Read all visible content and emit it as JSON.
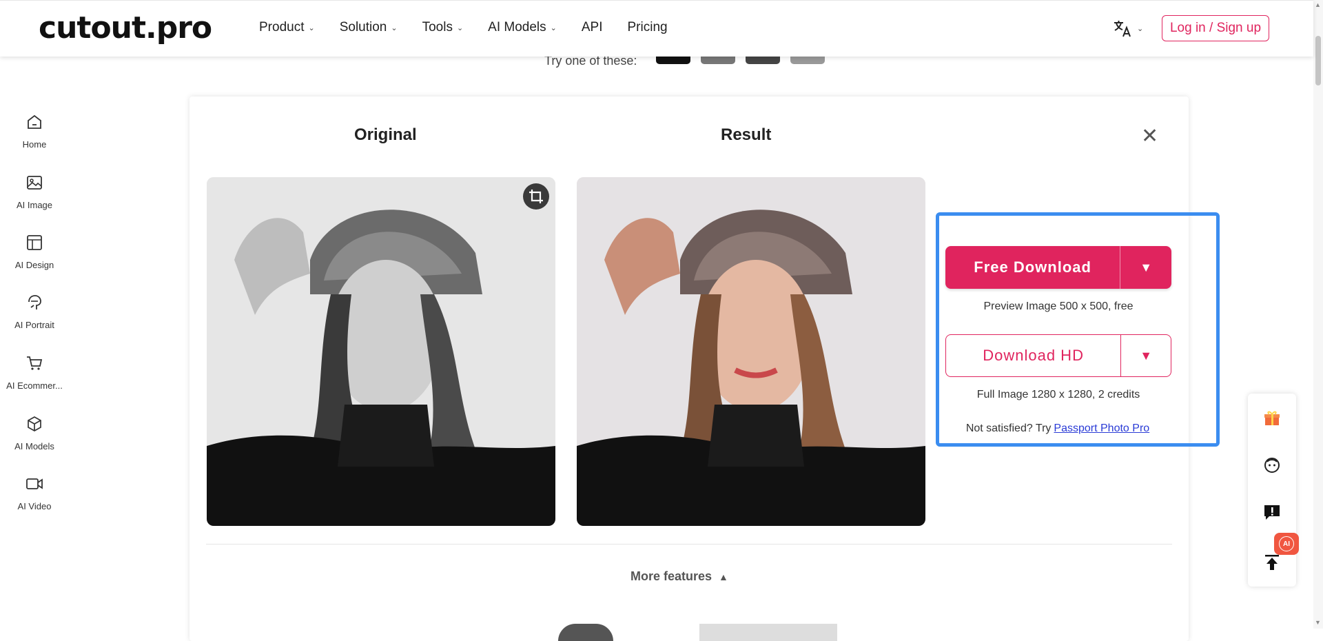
{
  "header": {
    "logo": "cutout.pro",
    "nav": [
      {
        "label": "Product",
        "has_dropdown": true
      },
      {
        "label": "Solution",
        "has_dropdown": true
      },
      {
        "label": "Tools",
        "has_dropdown": true
      },
      {
        "label": "AI Models",
        "has_dropdown": true
      },
      {
        "label": "API",
        "has_dropdown": false
      },
      {
        "label": "Pricing",
        "has_dropdown": false
      }
    ],
    "language_icon": "translate-icon",
    "login_label": "Log in / Sign up"
  },
  "try_text": "Try one of these:",
  "sidebar": {
    "items": [
      {
        "label": "Home",
        "icon": "home-icon"
      },
      {
        "label": "AI Image",
        "icon": "image-icon"
      },
      {
        "label": "AI Design",
        "icon": "layout-icon"
      },
      {
        "label": "AI Portrait",
        "icon": "portrait-icon"
      },
      {
        "label": "AI Ecommer...",
        "icon": "cart-icon"
      },
      {
        "label": "AI Models",
        "icon": "cube-icon"
      },
      {
        "label": "AI Video",
        "icon": "video-icon"
      }
    ]
  },
  "main": {
    "original_title": "Original",
    "result_title": "Result",
    "free_download_label": "Free Download",
    "free_note": "Preview Image 500 x 500, free",
    "download_hd_label": "Download HD",
    "hd_note": "Full Image 1280 x 1280, 2 credits",
    "not_satisfied": "Not satisfied? Try",
    "passport_link": "Passport Photo Pro",
    "more_features": "More features"
  },
  "float_bar": {
    "icons": [
      "gift-icon",
      "support-face-icon",
      "feedback-icon",
      "back-to-top-icon"
    ],
    "ai_badge": "AI"
  },
  "colors": {
    "accent": "#e0245e",
    "highlight": "#3b8df0",
    "link": "#2a3bd6"
  }
}
